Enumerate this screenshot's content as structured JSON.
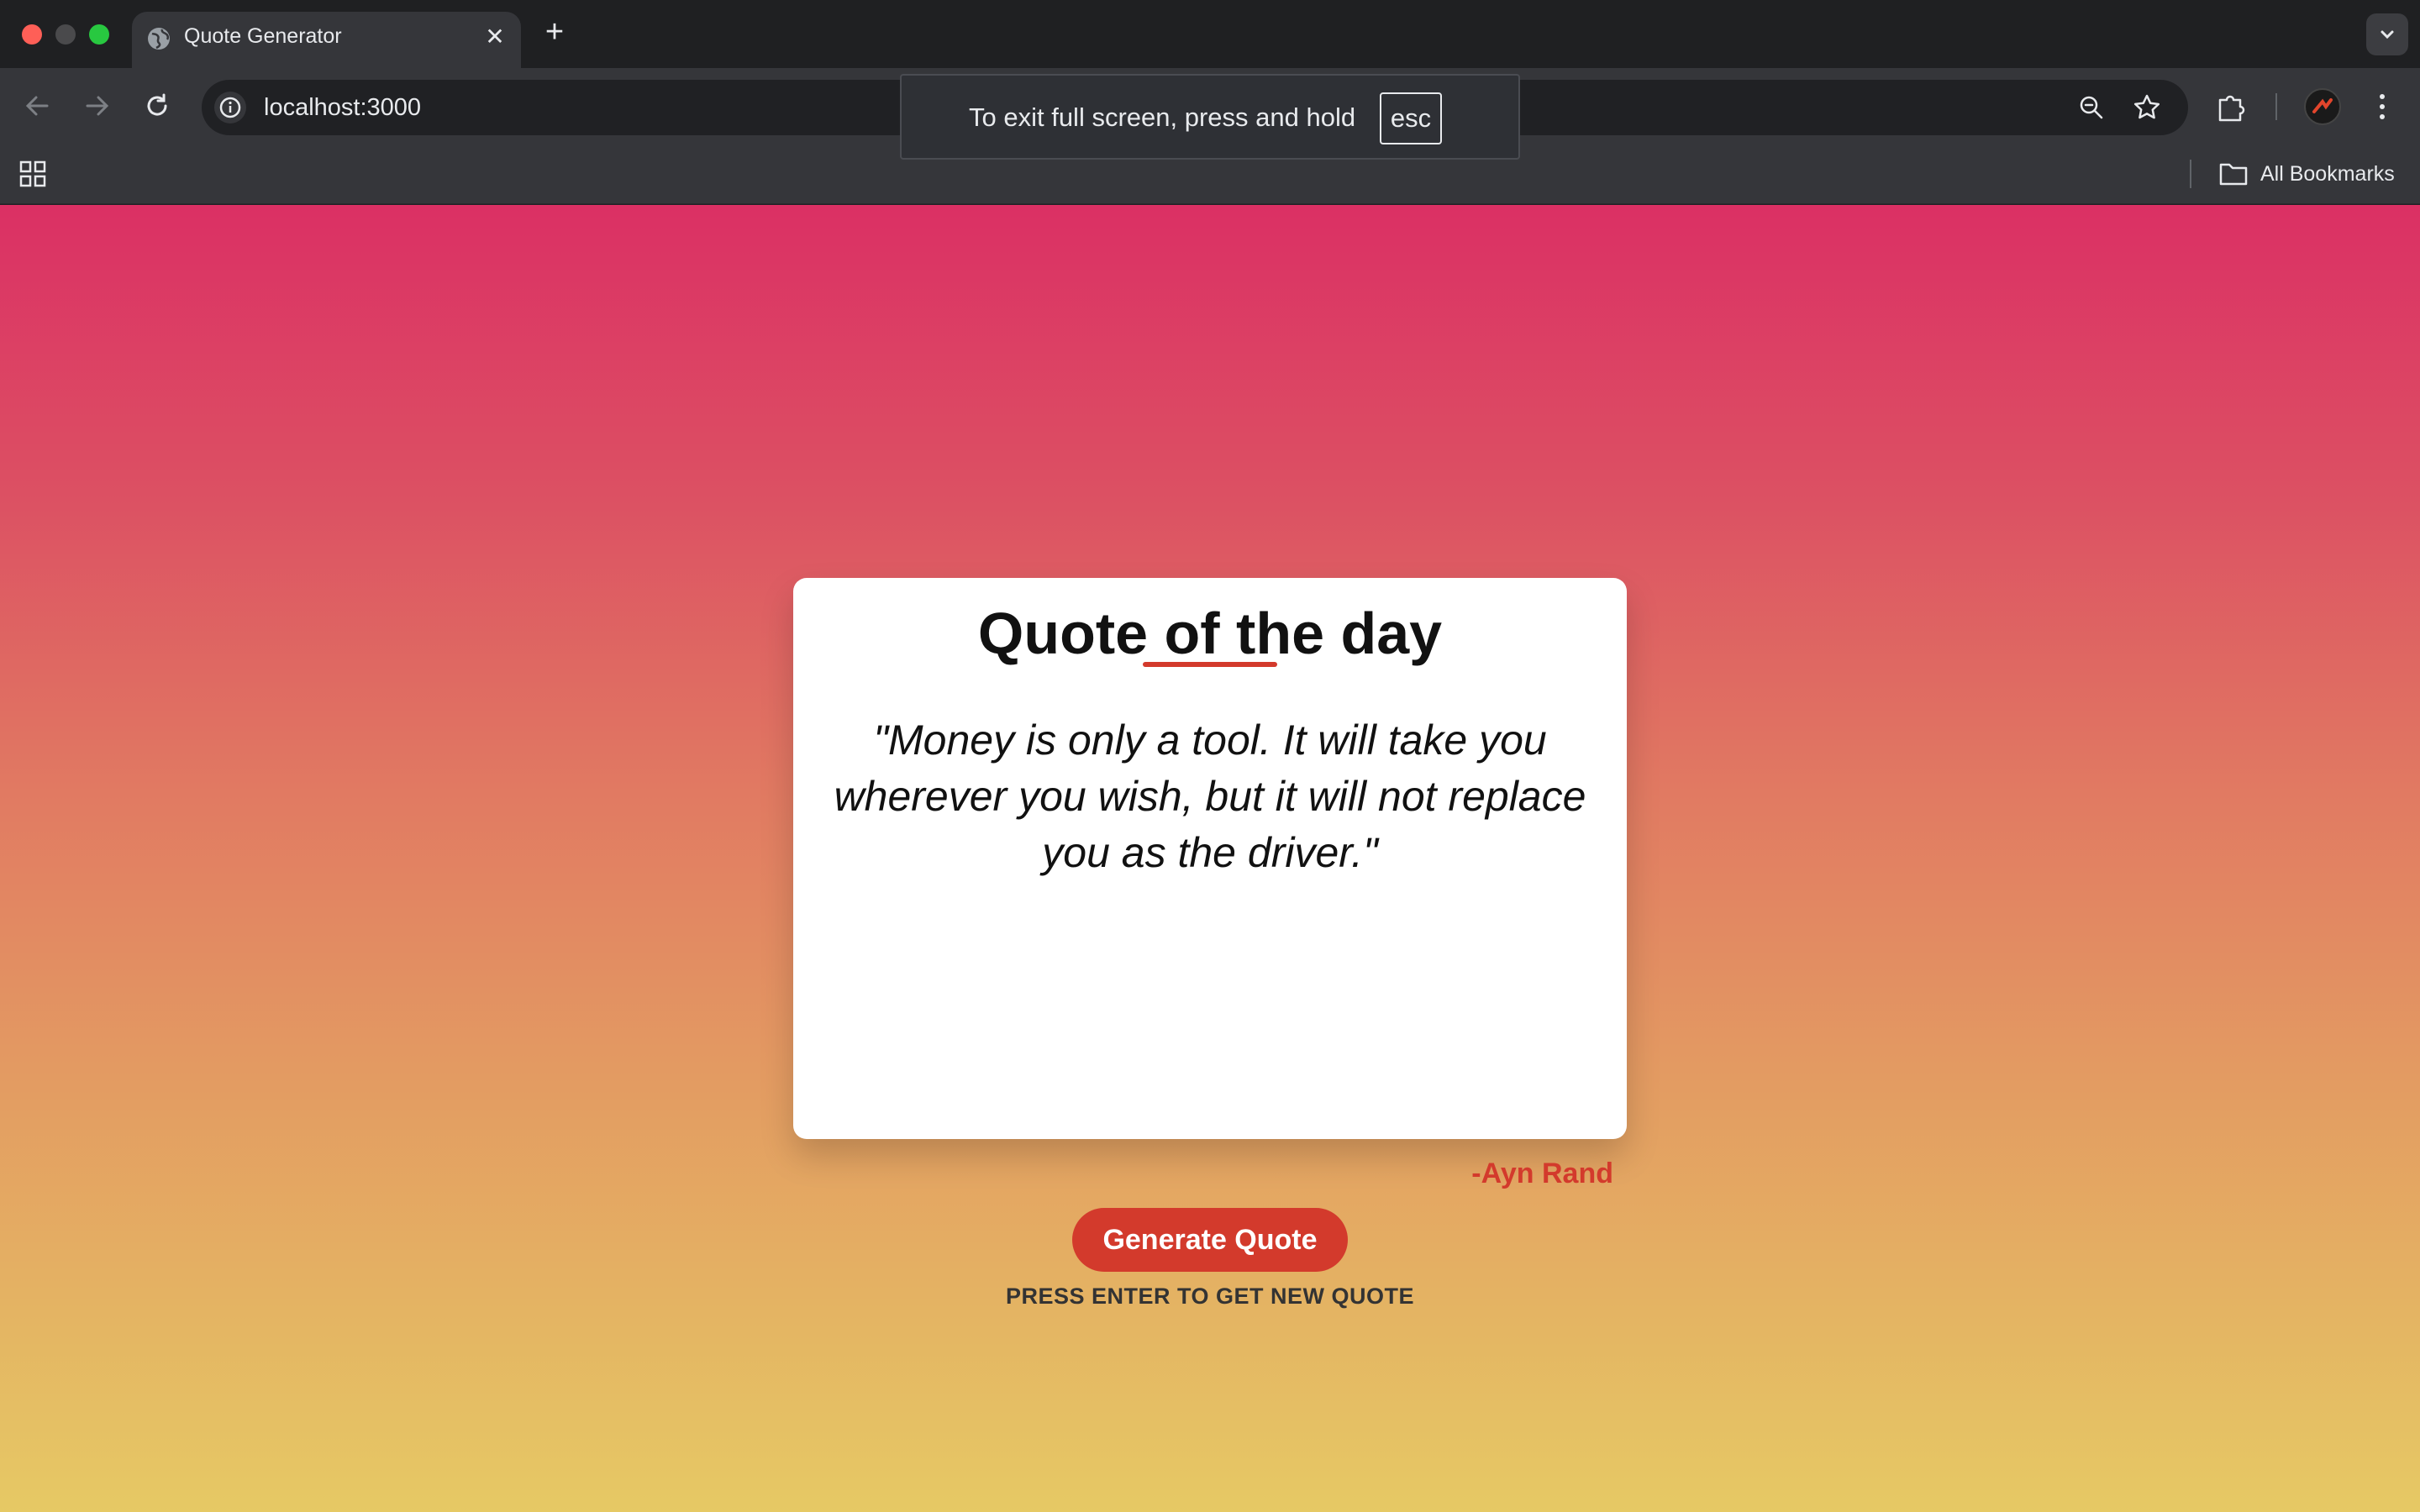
{
  "browser": {
    "tab_title": "Quote Generator",
    "new_tab_label": "+",
    "url": "localhost:3000",
    "bookmarks_label": "All Bookmarks"
  },
  "fullscreen_toast": {
    "message": "To exit full screen, press and hold",
    "key": "esc"
  },
  "card": {
    "title": "Quote of the day",
    "quote": "\"Money is only a tool. It will take you wherever you wish, but it will not replace you as the driver.\"",
    "author": "-Ayn Rand",
    "button_label": "Generate Quote",
    "hint": "PRESS ENTER TO GET NEW QUOTE"
  },
  "colors": {
    "accent": "#d33a2c",
    "gradient_top": "#db3064",
    "gradient_bottom": "#e6c964"
  }
}
